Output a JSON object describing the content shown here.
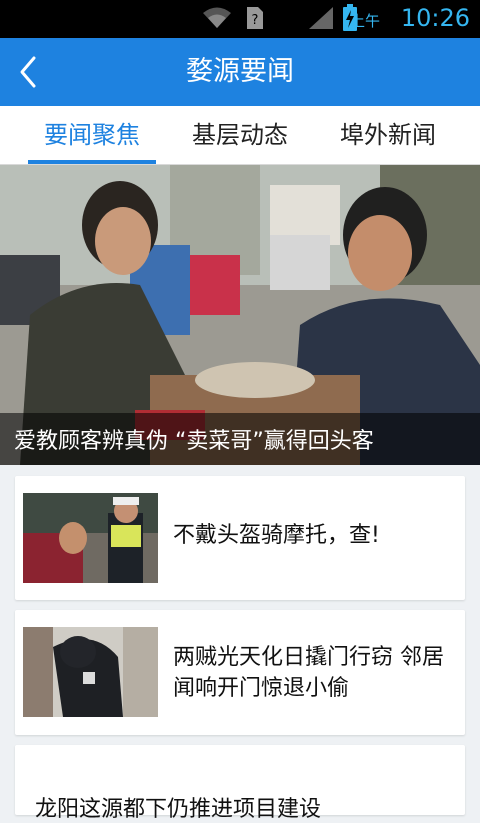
{
  "status_bar": {
    "ampm": "上午",
    "time": "10:26"
  },
  "header": {
    "title": "婺源要闻"
  },
  "tabs": [
    {
      "label": "要闻聚焦",
      "active": true
    },
    {
      "label": "基层动态",
      "active": false
    },
    {
      "label": "埠外新闻",
      "active": false
    }
  ],
  "hero": {
    "caption": "爱教顾客辨真伪 “卖菜哥”赢得回头客"
  },
  "news": [
    {
      "headline": "不戴头盔骑摩托，查!"
    },
    {
      "headline": "两贼光天化日撬门行窃 邻居闻响开门惊退小偷"
    },
    {
      "headline": "龙阳这源都下仍推进项目建设"
    }
  ],
  "colors": {
    "brand_blue": "#1e82e0",
    "status_accent": "#35b6f0"
  }
}
